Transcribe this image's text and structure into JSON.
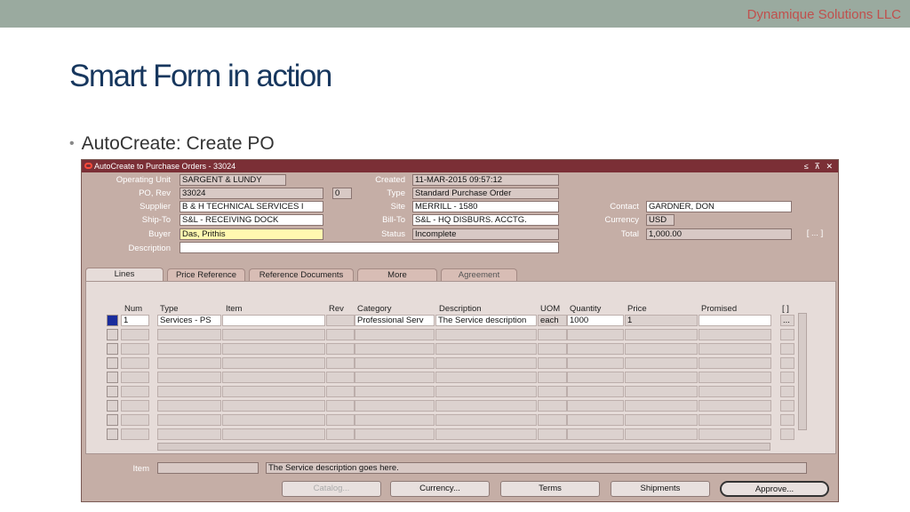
{
  "slide": {
    "company": "Dynamique Solutions LLC",
    "title": "Smart Form in action",
    "bullet": "AutoCreate: Create PO"
  },
  "window": {
    "title": "AutoCreate to Purchase Orders - 33024",
    "controls": "≤ ⊼ ✕"
  },
  "header": {
    "operating_unit_label": "Operating Unit",
    "operating_unit": "SARGENT & LUNDY",
    "po_rev_label": "PO, Rev",
    "po": "33024",
    "rev": "0",
    "supplier_label": "Supplier",
    "supplier": "B & H TECHNICAL SERVICES I",
    "ship_to_label": "Ship-To",
    "ship_to": "S&L - RECEIVING DOCK",
    "buyer_label": "Buyer",
    "buyer": "Das, Prithis",
    "description_label": "Description",
    "description": "",
    "created_label": "Created",
    "created": "11-MAR-2015 09:57:12",
    "type_label": "Type",
    "type": "Standard Purchase Order",
    "site_label": "Site",
    "site": "MERRILL - 1580",
    "bill_to_label": "Bill-To",
    "bill_to": "S&L - HQ DISBURS. ACCTG.",
    "status_label": "Status",
    "status": "Incomplete",
    "contact_label": "Contact",
    "contact": "GARDNER, DON",
    "currency_label": "Currency",
    "currency": "USD",
    "total_label": "Total",
    "total": "1,000.00",
    "dff": "[ ... ]"
  },
  "tabs": [
    "Lines",
    "Price Reference",
    "Reference Documents",
    "More",
    "Agreement"
  ],
  "lines": {
    "columns": [
      "Num",
      "Type",
      "Item",
      "Rev",
      "Category",
      "Description",
      "UOM",
      "Quantity",
      "Price",
      "Promised",
      "[ ]"
    ],
    "rows": [
      {
        "num": "1",
        "type": "Services - PS",
        "item": "",
        "rev": "",
        "category": "Professional Serv",
        "description": "The Service description",
        "uom": "each",
        "quantity": "1000",
        "price": "1",
        "promised": "",
        "dff": "..."
      }
    ]
  },
  "footer": {
    "item_label": "Item",
    "item": "",
    "item_description": "The Service description goes here."
  },
  "buttons": {
    "catalog": "Catalog...",
    "currency": "Currency...",
    "terms": "Terms",
    "shipments": "Shipments",
    "approve": "Approve..."
  },
  "colors": {
    "title_bar": "#7b2f36",
    "window_bg": "#c5aea6",
    "slide_title": "#17375e",
    "company": "#c0504d",
    "selected_row": "#1a2c9c"
  }
}
